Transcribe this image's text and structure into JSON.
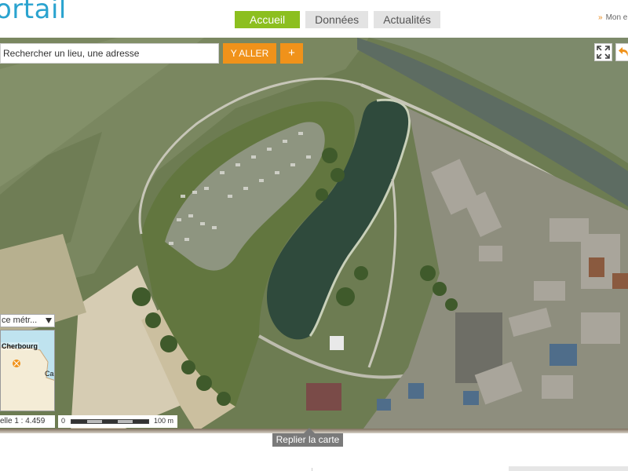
{
  "header": {
    "logo_text": "ortail",
    "nav": [
      {
        "label": "Accueil",
        "active": true
      },
      {
        "label": "Données",
        "active": false
      },
      {
        "label": "Actualités",
        "active": false
      }
    ],
    "account_link": "Mon e"
  },
  "map": {
    "search": {
      "placeholder": "Rechercher un lieu, une adresse",
      "value": ""
    },
    "go_label": "Y ALLER",
    "plus_label": "+",
    "icons": {
      "fullscreen": "fullscreen-icon",
      "back": "back-arrow-icon"
    },
    "layer_select": "ce métr...",
    "overview": {
      "city": "Cherbourg",
      "city2": "Ca"
    },
    "scale_ratio": "elle 1 :  4.459",
    "scale_bar": {
      "zero": "0",
      "distance": "100 m"
    }
  },
  "collapse_label": "Replier la carte",
  "colors": {
    "accent_green": "#8cbf1f",
    "accent_orange": "#f0921a",
    "nav_inactive": "#e3e3e3",
    "logo_blue": "#2aa3cf"
  }
}
